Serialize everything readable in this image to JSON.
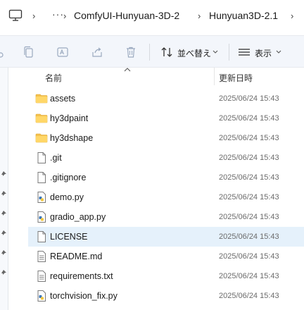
{
  "breadcrumb": {
    "items": [
      "ComfyUI-Hunyuan-3D-2",
      "Hunyuan3D-2.1"
    ],
    "more": "···"
  },
  "toolbar": {
    "sort_label": "並べ替え",
    "view_label": "表示"
  },
  "columns": {
    "name": "名前",
    "date": "更新日時"
  },
  "files": [
    {
      "name": "assets",
      "date": "2025/06/24 15:43",
      "type": "folder"
    },
    {
      "name": "hy3dpaint",
      "date": "2025/06/24 15:43",
      "type": "folder"
    },
    {
      "name": "hy3dshape",
      "date": "2025/06/24 15:43",
      "type": "folder"
    },
    {
      "name": ".git",
      "date": "2025/06/24 15:43",
      "type": "file"
    },
    {
      "name": ".gitignore",
      "date": "2025/06/24 15:43",
      "type": "file"
    },
    {
      "name": "demo.py",
      "date": "2025/06/24 15:43",
      "type": "python"
    },
    {
      "name": "gradio_app.py",
      "date": "2025/06/24 15:43",
      "type": "python"
    },
    {
      "name": "LICENSE",
      "date": "2025/06/24 15:43",
      "type": "file"
    },
    {
      "name": "README.md",
      "date": "2025/06/24 15:43",
      "type": "text"
    },
    {
      "name": "requirements.txt",
      "date": "2025/06/24 15:43",
      "type": "text"
    },
    {
      "name": "torchvision_fix.py",
      "date": "2025/06/24 15:43",
      "type": "python"
    }
  ]
}
